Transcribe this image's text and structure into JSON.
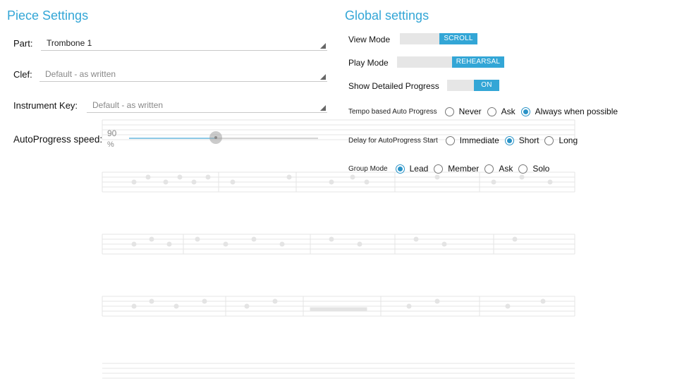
{
  "piece_settings": {
    "title": "Piece Settings",
    "part": {
      "label": "Part:",
      "value": "Trombone 1"
    },
    "clef": {
      "label": "Clef:",
      "value": "Default - as written"
    },
    "instrument_key": {
      "label": "Instrument Key:",
      "value": "Default - as written"
    },
    "autoprogress": {
      "label": "AutoProgress speed:",
      "value": "90",
      "unit": "%",
      "fraction": 0.9
    }
  },
  "global_settings": {
    "title": "Global settings",
    "view_mode": {
      "label": "View Mode",
      "state": "SCROLL"
    },
    "play_mode": {
      "label": "Play Mode",
      "state": "REHEARSAL"
    },
    "detailed_progress": {
      "label": "Show Detailed Progress",
      "state": "ON"
    },
    "tempo_auto_progress": {
      "label": "Tempo based Auto Progress",
      "options": [
        "Never",
        "Ask",
        "Always when possible"
      ],
      "selected": "Always when possible"
    },
    "delay_auto_progress": {
      "label": "Delay for AutoProgress Start",
      "options": [
        "Immediate",
        "Short",
        "Long"
      ],
      "selected": "Short"
    },
    "group_mode": {
      "label": "Group Mode",
      "options": [
        "Lead",
        "Member",
        "Ask",
        "Solo"
      ],
      "selected": "Lead"
    }
  },
  "colors": {
    "accent": "#33a6d6",
    "radio": "#2a93c7"
  }
}
